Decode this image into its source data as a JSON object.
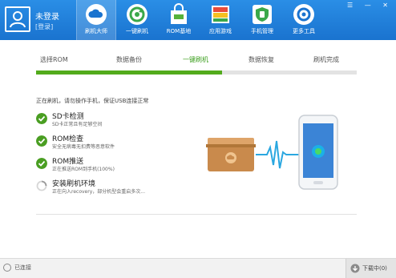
{
  "user": {
    "name": "未登录",
    "login_text": "[登录]"
  },
  "nav": [
    {
      "label": "刷机大师",
      "icon": "cloud-icon"
    },
    {
      "label": "一键刷机",
      "icon": "refresh-icon"
    },
    {
      "label": "ROM基地",
      "icon": "shopping-bag-icon"
    },
    {
      "label": "应用游戏",
      "icon": "apps-icon"
    },
    {
      "label": "手机管理",
      "icon": "shield-icon"
    },
    {
      "label": "更多工具",
      "icon": "tools-icon"
    }
  ],
  "window_controls": "☰ — ✕",
  "steps": [
    "选择ROM",
    "数据备份",
    "一键刷机",
    "数据恢复",
    "刷机完成"
  ],
  "active_step": 2,
  "progress_percent": 58,
  "status_text": "正在刷机，请勿操作手机，保证USB连接正常",
  "tasks": [
    {
      "title": "SD卡检测",
      "desc": "SD卡正常且有足够空间",
      "done": true
    },
    {
      "title": "ROM检查",
      "desc": "安全无病毒无扣费等恶意软件",
      "done": true
    },
    {
      "title": "ROM推送",
      "desc": "正在推送ROM到手机(100%)",
      "done": true
    },
    {
      "title": "安装刷机环境",
      "desc": "正在向入recovery，部分机型会重启多次...",
      "done": false
    }
  ],
  "footer": {
    "connection": "已连接",
    "download": "下载中(0)"
  },
  "colors": {
    "topbar": "#1a73cf",
    "accent_green": "#52ab1c",
    "check_green": "#4a9e22"
  }
}
